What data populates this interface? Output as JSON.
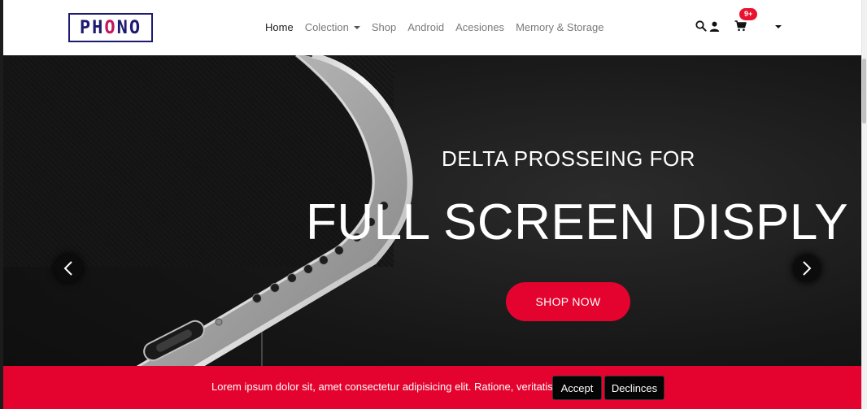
{
  "navbar": {
    "logo": {
      "text_left": "PH",
      "text_accent": "O",
      "text_right": "NO"
    },
    "links": [
      {
        "label": "Home",
        "active": true
      },
      {
        "label": "Colection",
        "has_dropdown": true
      },
      {
        "label": "Shop"
      },
      {
        "label": "Android"
      },
      {
        "label": "Acesiones"
      },
      {
        "label": "Memory & Storage"
      }
    ],
    "icons": [
      "search-icon",
      "user-icon",
      "cart-icon",
      "chevron-down-icon"
    ],
    "cart_badge": "9+",
    "colors": {
      "logo": "#1d1a6f",
      "badge": "#e8132f"
    }
  },
  "hero": {
    "subtitle": "DELTA PROSSEING FOR",
    "title": "FULL SCREEN DISPLY",
    "cta_label": "SHOP NOW",
    "prev_icon": "chevron-left-icon",
    "next_icon": "chevron-right-icon",
    "colors": {
      "cta": "#e4032e",
      "background": "#161616"
    }
  },
  "cookie_bar": {
    "message": "Lorem ipsum dolor sit, amet consectetur adipisicing elit. Ratione, veritatis.",
    "accept_label": "Accept",
    "decline_label": "Declinces",
    "colors": {
      "background": "#e4032e",
      "buttons": "#050505"
    }
  }
}
